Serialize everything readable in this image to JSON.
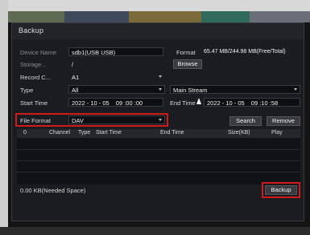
{
  "window": {
    "title": "Backup"
  },
  "form": {
    "device_name_label": "Device Name",
    "device_name_value": "sdb1(USB USB)",
    "format_label": "Format",
    "capacity": "65.47 MB/244.98 MB(Free/Total)",
    "browse_label": "Browse",
    "storage_label": "Storage...",
    "storage_value": "/",
    "record_channel_label": "Record C...",
    "record_channel_value": "A1",
    "type_label": "Type",
    "type_value": "All",
    "stream_value": "Main Stream",
    "start_time_label": "Start Time",
    "start_date": "2022 - 10 - 05",
    "start_clock": "09 :00 :00",
    "end_time_label": "End Time",
    "end_date": "2022 - 10 - 05",
    "end_clock": "09 :10 :58",
    "file_format_label": "File Format",
    "file_format_value": "DAV",
    "search_label": "Search",
    "remove_label": "Remove"
  },
  "table": {
    "columns": [
      "0",
      "Channel",
      "Type",
      "Start Time",
      "End Time",
      "Size(KB)",
      "Play"
    ]
  },
  "footer": {
    "needed_space": "0.00 KB(Needed Space)",
    "backup_label": "Backup"
  },
  "colors": {
    "highlight": "#d11a1a",
    "dialog_bg": "#1b1c21"
  }
}
